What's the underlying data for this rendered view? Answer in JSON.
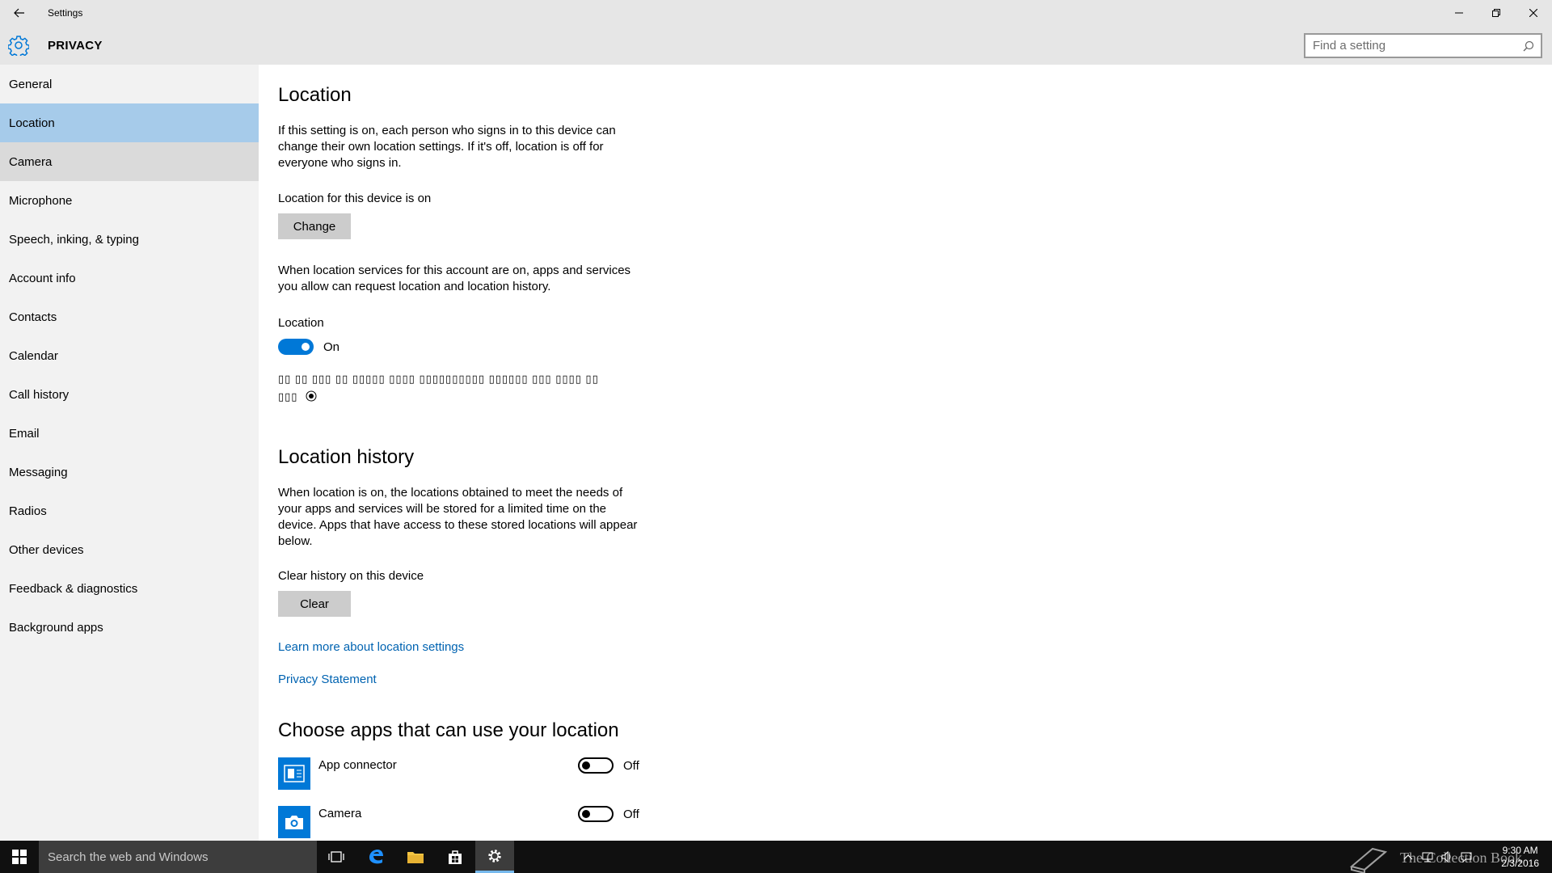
{
  "window": {
    "title": "Settings",
    "section": "PRIVACY",
    "search_placeholder": "Find a setting"
  },
  "sidebar": {
    "items": [
      {
        "label": "General"
      },
      {
        "label": "Location"
      },
      {
        "label": "Camera"
      },
      {
        "label": "Microphone"
      },
      {
        "label": "Speech, inking, & typing"
      },
      {
        "label": "Account info"
      },
      {
        "label": "Contacts"
      },
      {
        "label": "Calendar"
      },
      {
        "label": "Call history"
      },
      {
        "label": "Email"
      },
      {
        "label": "Messaging"
      },
      {
        "label": "Radios"
      },
      {
        "label": "Other devices"
      },
      {
        "label": "Feedback & diagnostics"
      },
      {
        "label": "Background apps"
      }
    ],
    "selected": "Location"
  },
  "location": {
    "heading": "Location",
    "intro": "If this setting is on, each person who signs in to this device can change their own location settings. If it's off, location is off for everyone who signs in.",
    "device_status": "Location for this device is on",
    "change_button": "Change",
    "services_text": "When location services for this account are on, apps and services you allow can request location and location history.",
    "toggle_label": "Location",
    "toggle_state": "On",
    "garbled_line1": "▯▯ ▯▯ ▯▯▯ ▯▯ ▯▯▯▯▯ ▯▯▯▯ ▯▯▯▯▯▯▯▯▯▯ ▯▯▯▯▯▯ ▯▯▯ ▯▯▯▯ ▯▯",
    "garbled_line2": "▯▯▯"
  },
  "history": {
    "heading": "Location history",
    "text": "When location is on, the locations obtained to meet the needs of your apps and services will be stored for a limited time on the device. Apps that have access to these stored locations will appear below.",
    "clear_label": "Clear history on this device",
    "clear_button": "Clear",
    "learn_more_link": "Learn more about location settings",
    "privacy_link": "Privacy Statement"
  },
  "apps": {
    "heading": "Choose apps that can use your location",
    "list": [
      {
        "name": "App connector",
        "state": "Off",
        "icon": "app-connector-icon"
      },
      {
        "name": "Camera",
        "state": "Off",
        "icon": "camera-icon"
      }
    ]
  },
  "taskbar": {
    "search_text": "Search the web and Windows",
    "time": "9:30 AM",
    "date": "2/3/2016",
    "watermark_text": "The Collection Book"
  },
  "colors": {
    "accent": "#0078d7",
    "sidebar_selected": "#a6cbea",
    "link": "#0063b1",
    "header_bg": "#e6e6e6",
    "sidebar_bg": "#f2f2f2",
    "taskbar_bg": "#101010"
  }
}
